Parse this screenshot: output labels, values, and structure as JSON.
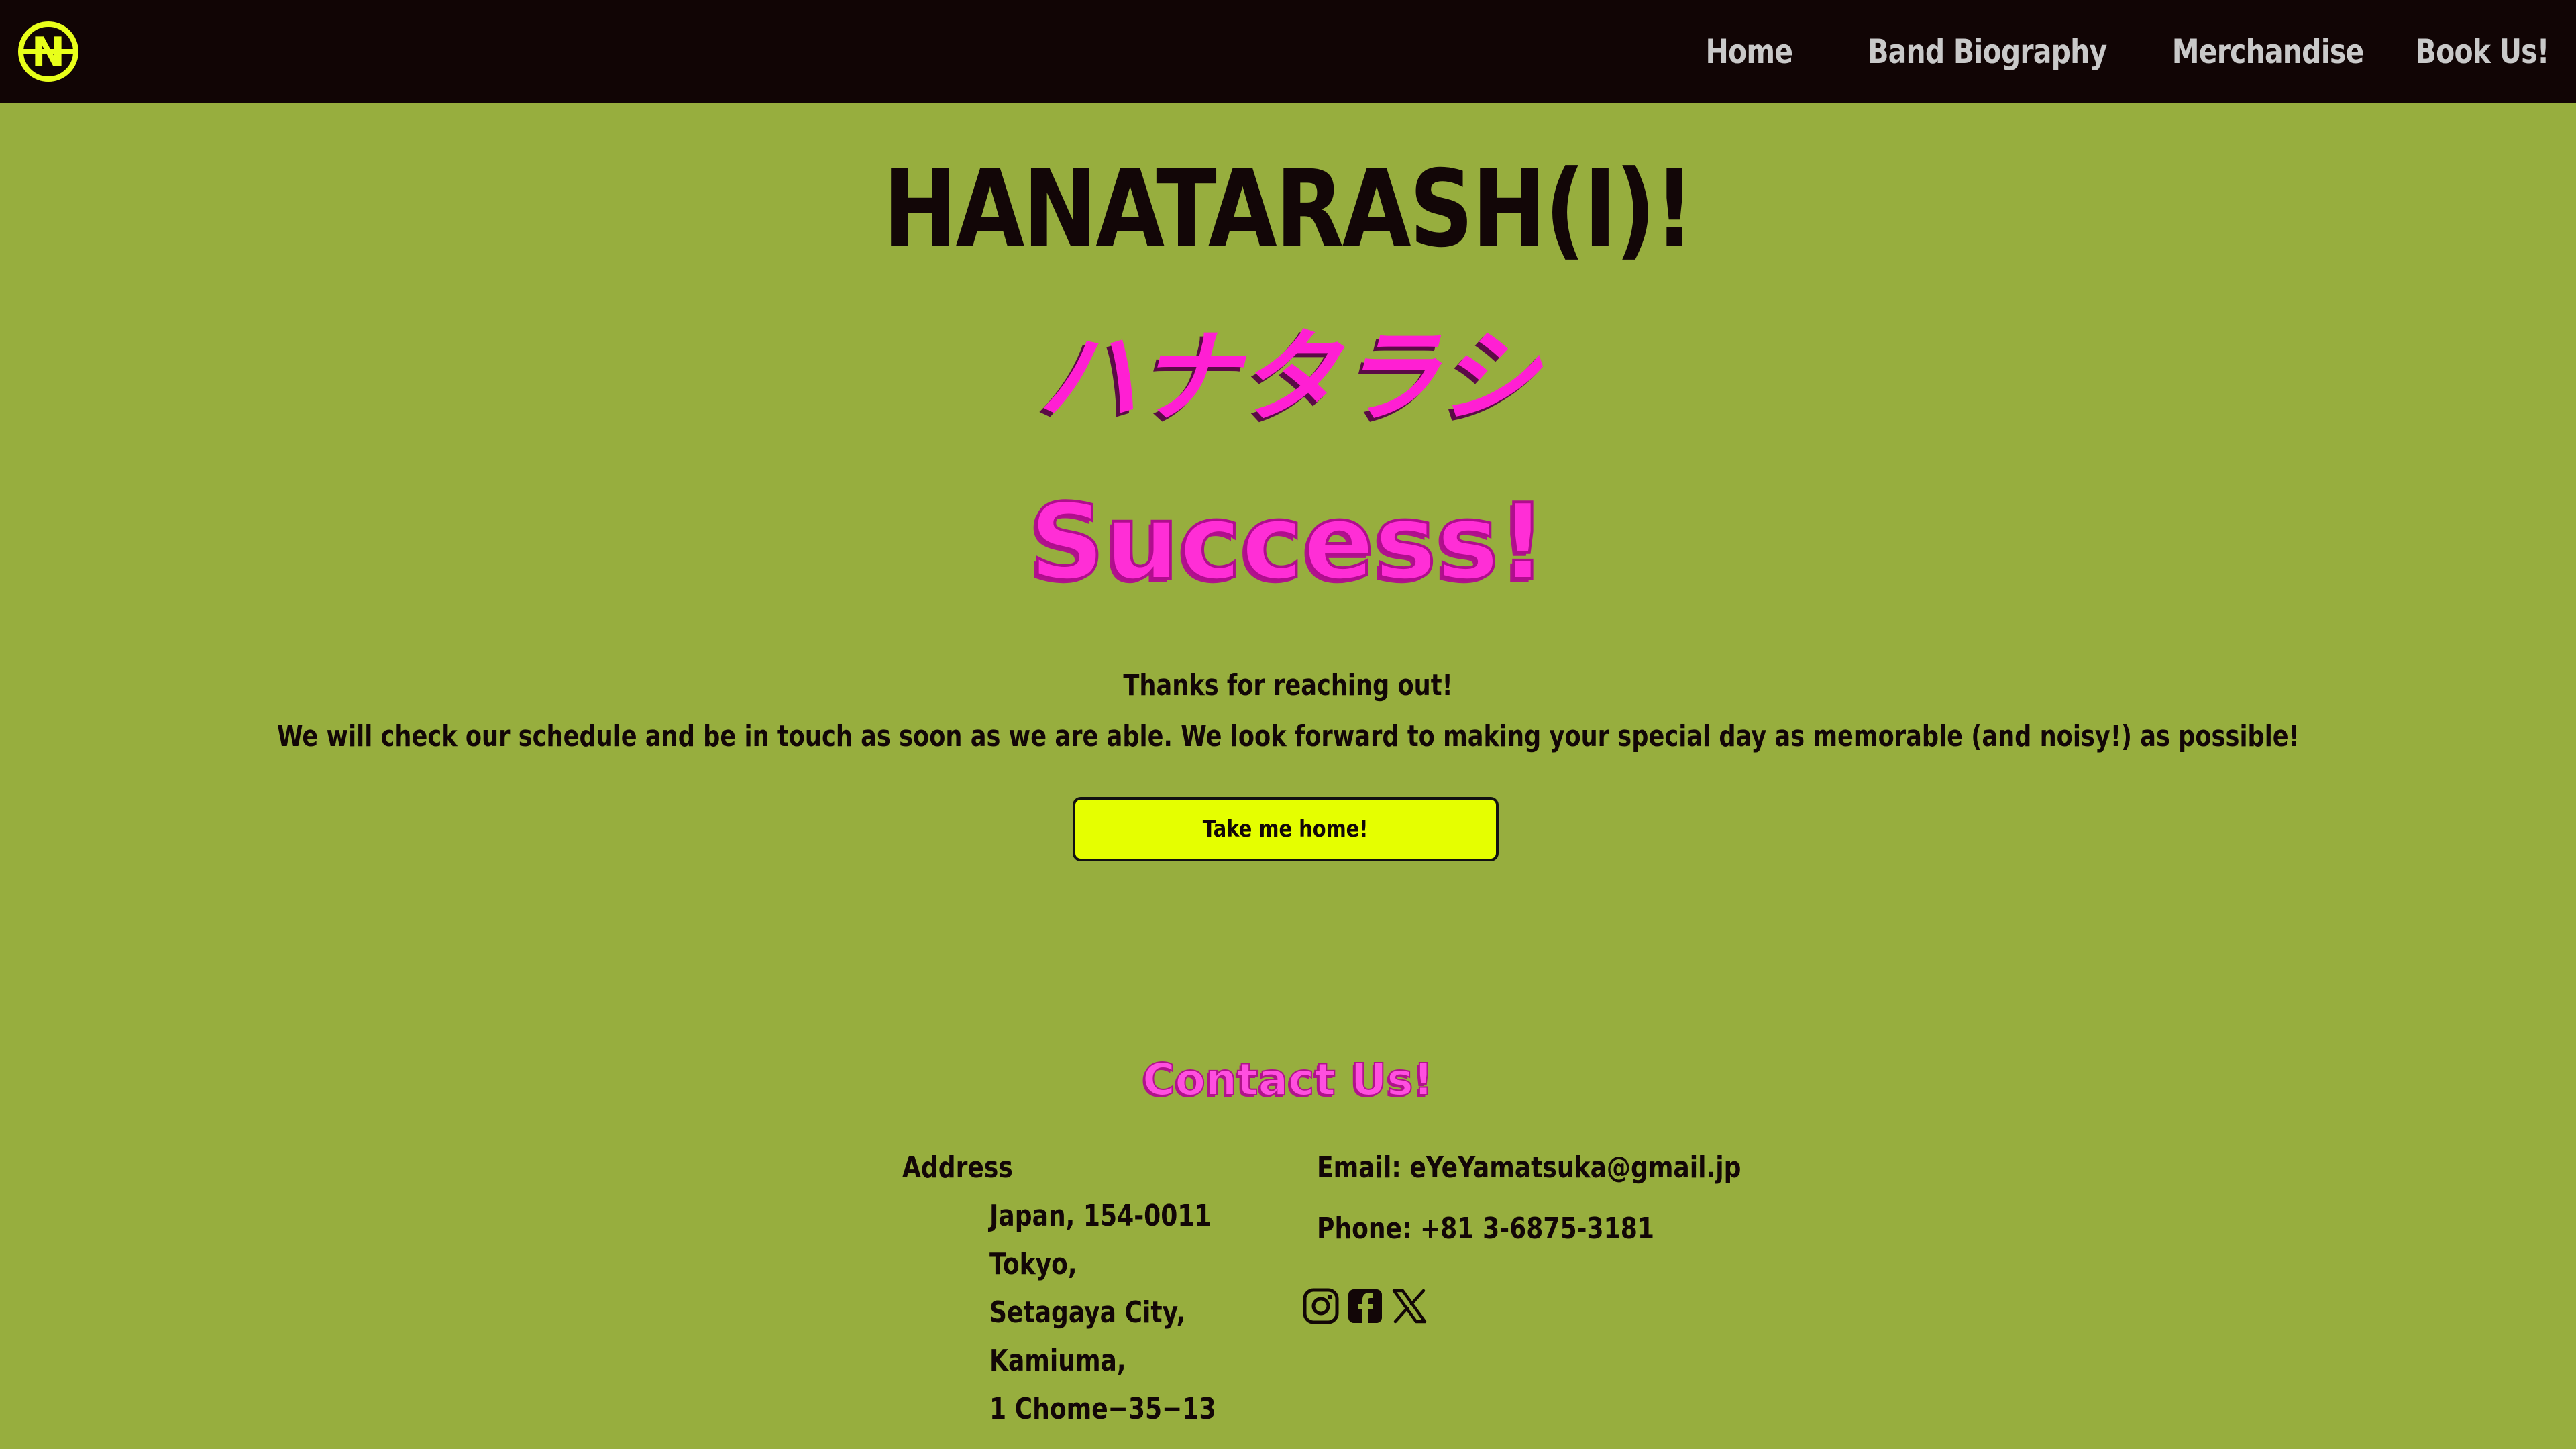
{
  "nav": {
    "logo_letter": "N",
    "links": [
      {
        "label": "Home"
      },
      {
        "label": "Band Biography"
      },
      {
        "label": "Merchandise"
      },
      {
        "label": "Book Us!"
      }
    ]
  },
  "hero": {
    "band_name": "HANATARASH(I)!",
    "band_name_jp": "ハナタラシ",
    "status_title": "Success!",
    "thanks_line_1": "Thanks for reaching out!",
    "thanks_line_2": "We will check our schedule and be in touch as soon as we are able. We look forward to making your special day as memorable (and noisy!) as possible!",
    "home_button_label": "Take me home!"
  },
  "contact": {
    "heading": "Contact Us!",
    "address_label": "Address",
    "address_lines": [
      "Japan, 154-0011",
      "Tokyo,",
      "Setagaya City,",
      "Kamiuma,",
      "1 Chome−35−13"
    ],
    "email": "Email: eYeYamatsuka@gmail.jp",
    "phone": "Phone: +81 3-6875-3181",
    "social_icons": [
      "instagram-icon",
      "facebook-icon",
      "x-icon"
    ]
  },
  "colors": {
    "page_background": "#97ae3e",
    "nav_background": "#110505",
    "nav_text": "#c9c9c9",
    "accent_pink": "#ff1fd3",
    "button_yellow": "#e5ff00",
    "logo_yellow": "#e8ff1a",
    "text_dark": "#120607"
  }
}
